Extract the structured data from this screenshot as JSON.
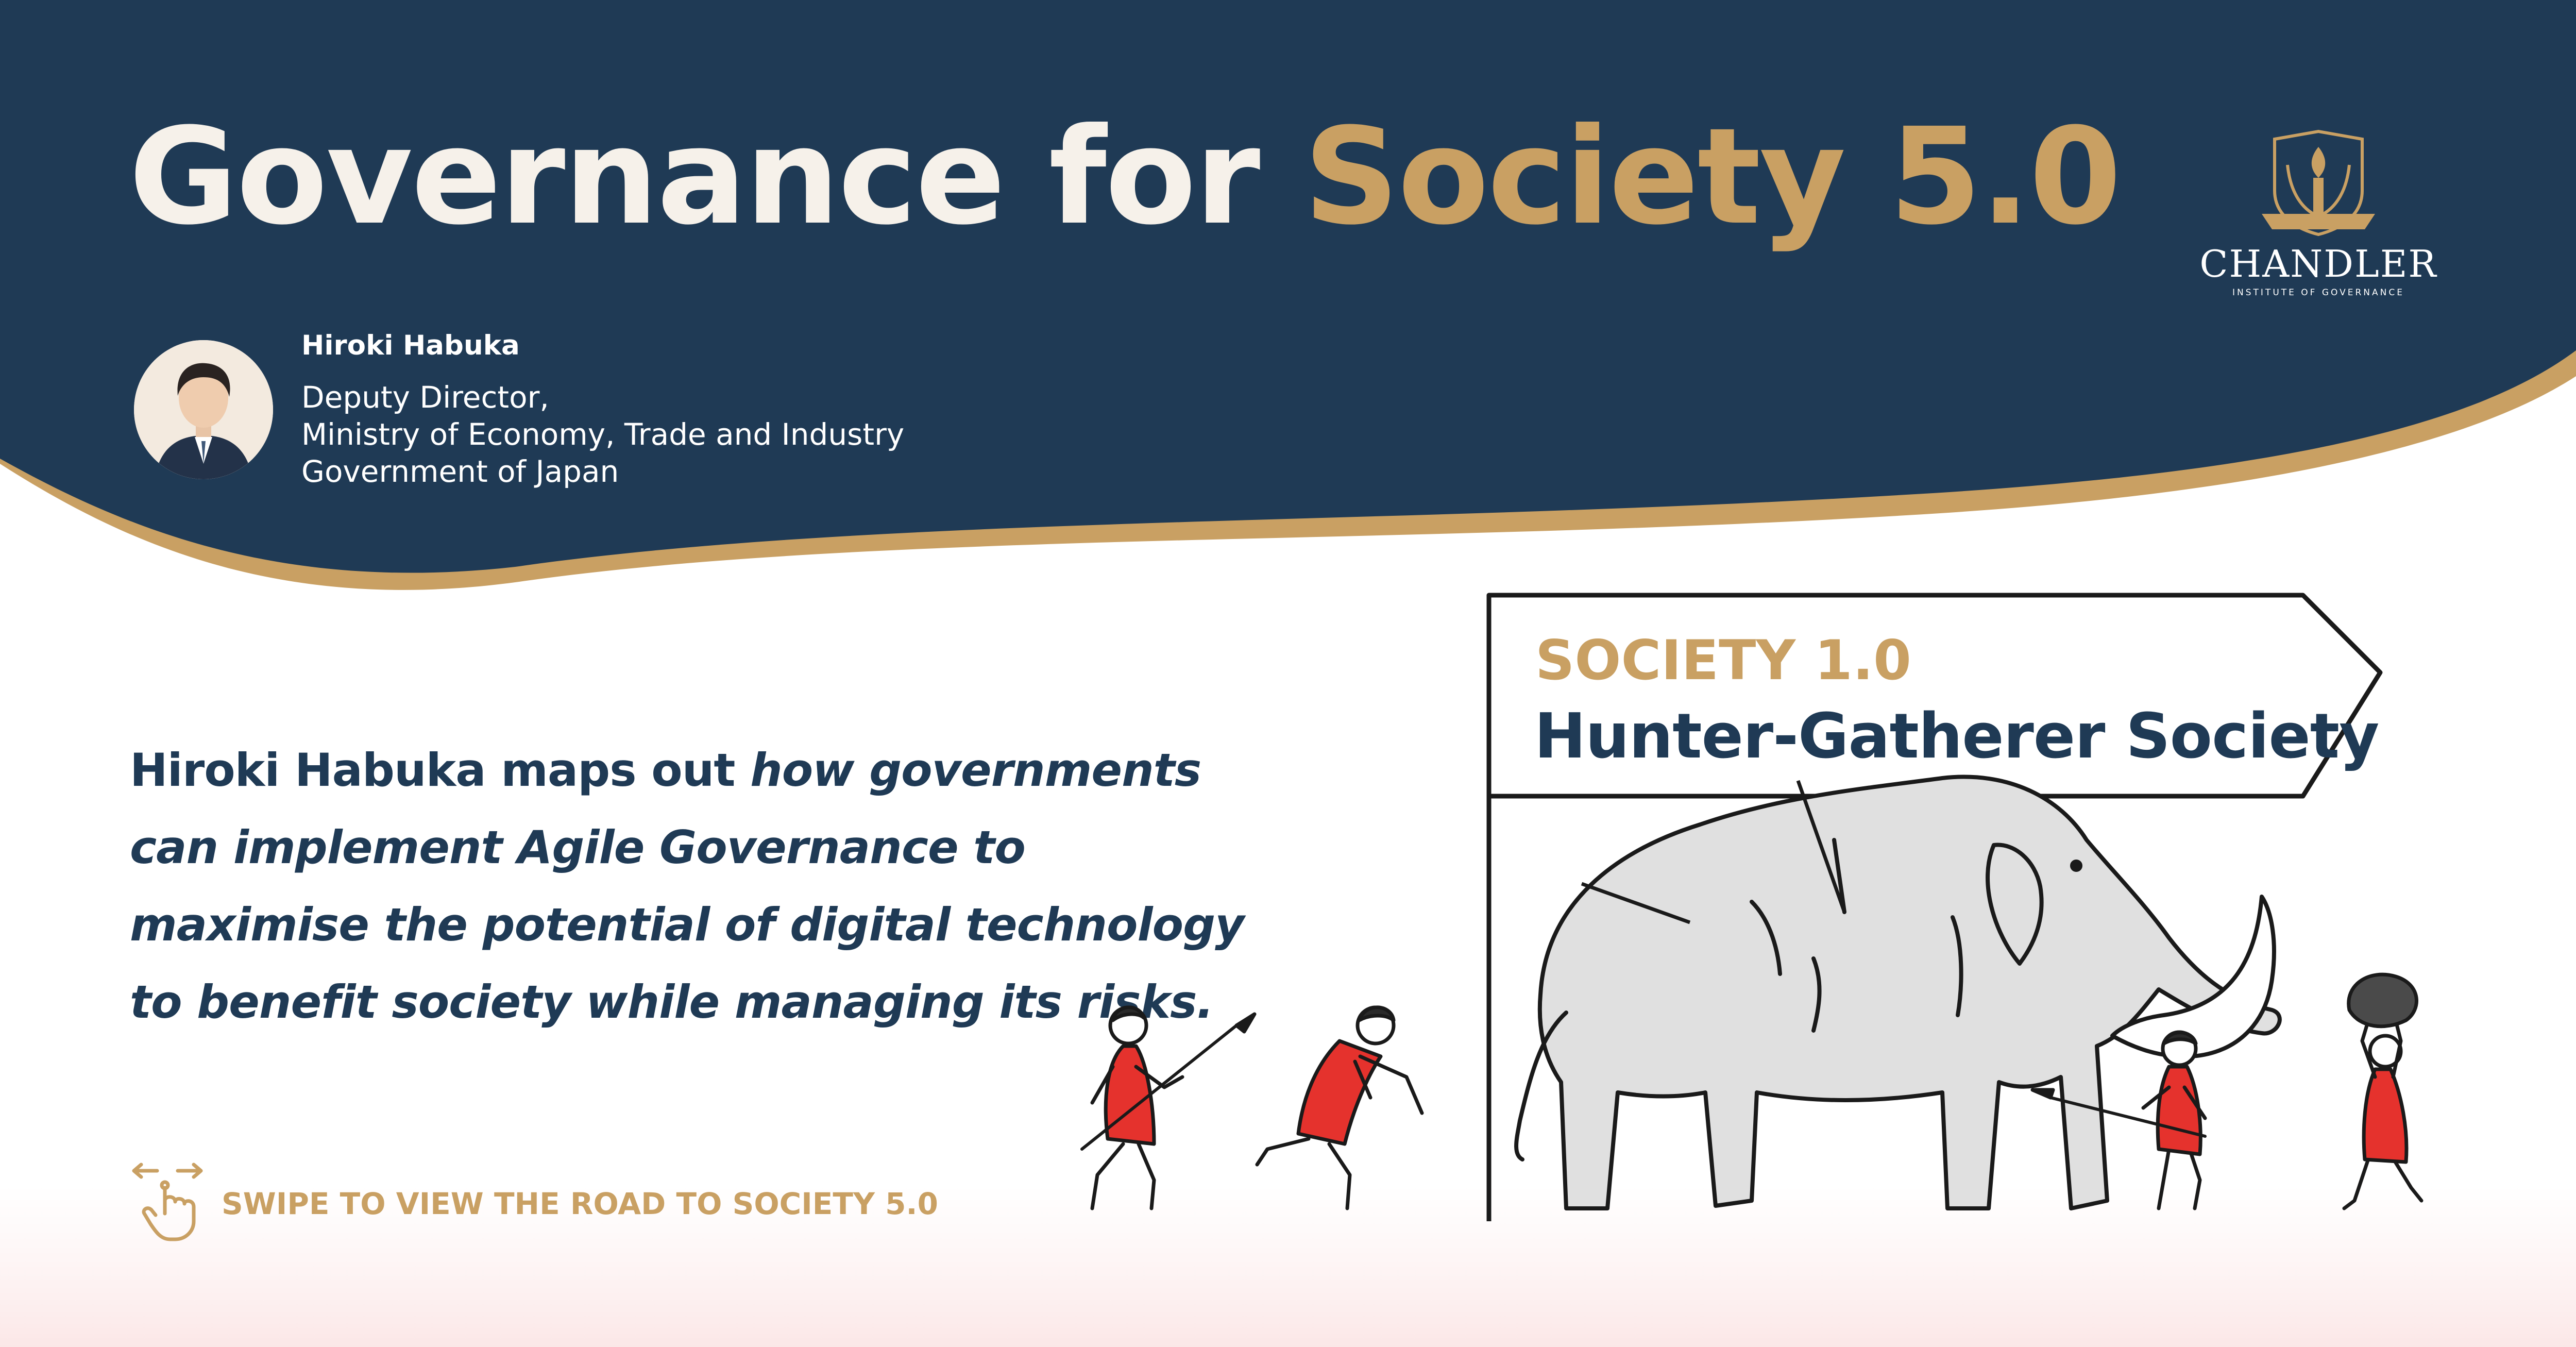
{
  "header": {
    "title_part1": "Governance for ",
    "title_part2": "Society 5.0"
  },
  "author": {
    "name": "Hiroki Habuka",
    "role_line1": "Deputy Director,",
    "role_line2": "Ministry of Economy, Trade and Industry",
    "role_line3": "Government of Japan"
  },
  "logo": {
    "wordmark": "CHANDLER",
    "subline": "INSTITUTE OF GOVERNANCE"
  },
  "summary": {
    "part1": "Hiroki Habuka maps out ",
    "part2": "how governments can implement Agile Governance to maximise the potential of digital technology to benefit society while managing its risks."
  },
  "cta": {
    "swipe_label": "SWIPE TO VIEW THE ROAD TO SOCIETY 5.0",
    "icon": "swipe-hand-icon"
  },
  "signpost": {
    "era": "SOCIETY 1.0",
    "name": "Hunter-Gatherer Society"
  },
  "colors": {
    "navy": "#1f3a55",
    "gold": "#c9a063",
    "cream": "#f6f1ea",
    "red": "#e5322d",
    "mammoth_grey": "#dcdcdc"
  }
}
